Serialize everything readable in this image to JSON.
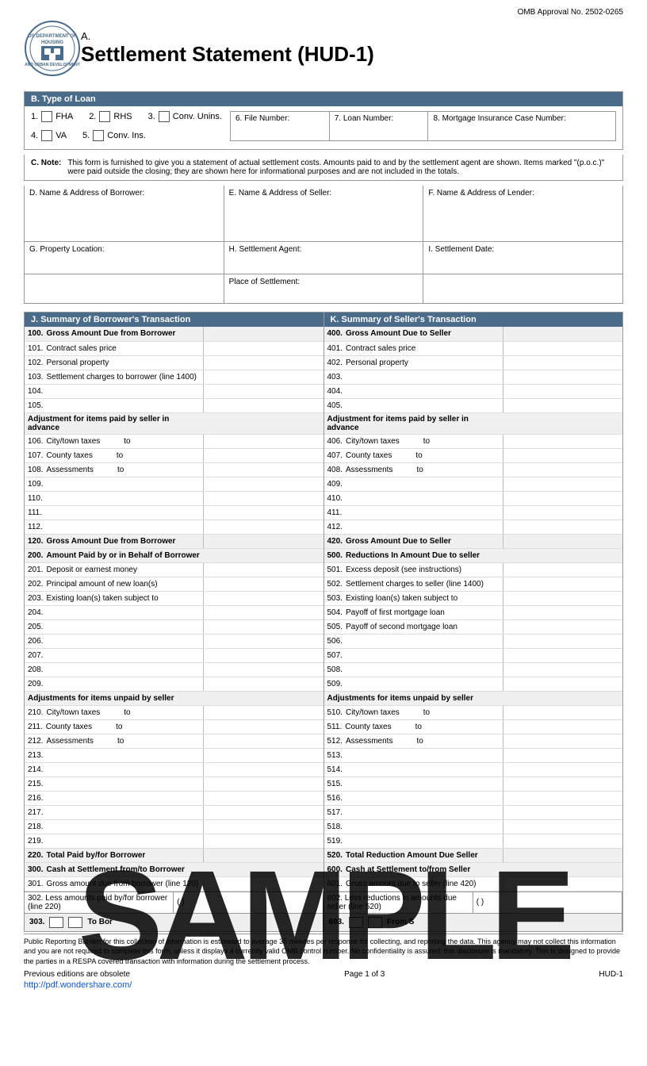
{
  "omb": {
    "label": "OMB Approval No. 2502-0265"
  },
  "title": {
    "prefix": "A.",
    "main": "Settlement Statement (HUD-1)"
  },
  "section_b": {
    "header": "B. Type of Loan",
    "items": [
      {
        "num": "1.",
        "label": "FHA"
      },
      {
        "num": "2.",
        "label": "RHS"
      },
      {
        "num": "3.",
        "label": "Conv. Unins."
      },
      {
        "num": "4.",
        "label": "VA"
      },
      {
        "num": "5.",
        "label": "Conv. Ins."
      }
    ],
    "fields": [
      {
        "label": "6. File Number:"
      },
      {
        "label": "7. Loan Number:"
      },
      {
        "label": "8. Mortgage Insurance Case Number:"
      }
    ]
  },
  "note_c": {
    "label": "C. Note:",
    "text": "This form is furnished to give you a statement of actual settlement costs. Amounts paid to and by the settlement agent are shown. Items marked \"(p.o.c.)\" were paid outside the closing; they are shown here for informational purposes and are not included in the totals."
  },
  "addresses": {
    "borrower": {
      "label": "D. Name & Address of Borrower:"
    },
    "seller": {
      "label": "E. Name & Address of Seller:"
    },
    "lender": {
      "label": "F. Name & Address of Lender:"
    }
  },
  "property": {
    "location": {
      "label": "G. Property Location:"
    },
    "agent": {
      "label": "H. Settlement Agent:"
    },
    "date": {
      "label": "I. Settlement Date:"
    },
    "place": {
      "label": "Place of Settlement:"
    }
  },
  "summary_borrower": {
    "header": "J. Summary of Borrower's Transaction",
    "rows": [
      {
        "num": "100.",
        "label": "Gross Amount Due from Borrower",
        "bold": true,
        "val": ""
      },
      {
        "num": "101.",
        "label": "Contract sales price",
        "bold": false,
        "val": ""
      },
      {
        "num": "102.",
        "label": "Personal property",
        "bold": false,
        "val": ""
      },
      {
        "num": "103.",
        "label": "Settlement charges to borrower (line 1400)",
        "bold": false,
        "val": ""
      },
      {
        "num": "104.",
        "label": "",
        "bold": false,
        "val": ""
      },
      {
        "num": "105.",
        "label": "",
        "bold": false,
        "val": ""
      },
      {
        "num": "",
        "label": "Adjustment for items paid by seller in advance",
        "bold": true,
        "val": null
      },
      {
        "num": "106.",
        "label": "City/town taxes",
        "bold": false,
        "val": "",
        "to": "to"
      },
      {
        "num": "107.",
        "label": "County taxes",
        "bold": false,
        "val": "",
        "to": "to"
      },
      {
        "num": "108.",
        "label": "Assessments",
        "bold": false,
        "val": "",
        "to": "to"
      },
      {
        "num": "109.",
        "label": "",
        "bold": false,
        "val": ""
      },
      {
        "num": "110.",
        "label": "",
        "bold": false,
        "val": ""
      },
      {
        "num": "111.",
        "label": "",
        "bold": false,
        "val": ""
      },
      {
        "num": "112.",
        "label": "",
        "bold": false,
        "val": ""
      },
      {
        "num": "120.",
        "label": "Gross Amount Due from Borrower",
        "bold": true,
        "val": ""
      },
      {
        "num": "200.",
        "label": "Amount Paid by or in Behalf of Borrower",
        "bold": true,
        "val": null
      },
      {
        "num": "201.",
        "label": "Deposit or earnest money",
        "bold": false,
        "val": ""
      },
      {
        "num": "202.",
        "label": "Principal amount of new loan(s)",
        "bold": false,
        "val": ""
      },
      {
        "num": "203.",
        "label": "Existing loan(s) taken subject to",
        "bold": false,
        "val": ""
      },
      {
        "num": "204.",
        "label": "",
        "bold": false,
        "val": ""
      },
      {
        "num": "205.",
        "label": "",
        "bold": false,
        "val": ""
      },
      {
        "num": "206.",
        "label": "",
        "bold": false,
        "val": ""
      },
      {
        "num": "207.",
        "label": "",
        "bold": false,
        "val": ""
      },
      {
        "num": "208.",
        "label": "",
        "bold": false,
        "val": ""
      },
      {
        "num": "209.",
        "label": "",
        "bold": false,
        "val": ""
      },
      {
        "num": "",
        "label": "Adjustments for items unpaid by seller",
        "bold": true,
        "val": null
      },
      {
        "num": "210.",
        "label": "City/town taxes",
        "bold": false,
        "val": "",
        "to": "to"
      },
      {
        "num": "211.",
        "label": "County taxes",
        "bold": false,
        "val": "",
        "to": "to"
      },
      {
        "num": "212.",
        "label": "Assessments",
        "bold": false,
        "val": "",
        "to": "to"
      },
      {
        "num": "213.",
        "label": "",
        "bold": false,
        "val": ""
      },
      {
        "num": "214.",
        "label": "",
        "bold": false,
        "val": ""
      },
      {
        "num": "215.",
        "label": "",
        "bold": false,
        "val": ""
      },
      {
        "num": "216.",
        "label": "",
        "bold": false,
        "val": ""
      },
      {
        "num": "217.",
        "label": "",
        "bold": false,
        "val": ""
      },
      {
        "num": "218.",
        "label": "",
        "bold": false,
        "val": ""
      },
      {
        "num": "219.",
        "label": "",
        "bold": false,
        "val": ""
      },
      {
        "num": "220.",
        "label": "Total Paid by/for Borrower",
        "bold": true,
        "val": ""
      },
      {
        "num": "300.",
        "label": "Cash at Settlement from/to Borrower",
        "bold": true,
        "val": null
      },
      {
        "num": "301.",
        "label": "Gross amount due from borrower (line 120)",
        "bold": false,
        "val": ""
      }
    ],
    "line302": "302. Less amounts paid by/for borrower (line 220)",
    "line302_val": "(                    )",
    "line303": "303.",
    "line303_checkbox1": "",
    "line303_label": "To Bor"
  },
  "summary_seller": {
    "header": "K. Summary of Seller's Transaction",
    "rows": [
      {
        "num": "400.",
        "label": "Gross Amount Due to Seller",
        "bold": true,
        "val": ""
      },
      {
        "num": "401.",
        "label": "Contract sales price",
        "bold": false,
        "val": ""
      },
      {
        "num": "402.",
        "label": "Personal property",
        "bold": false,
        "val": ""
      },
      {
        "num": "403.",
        "label": "",
        "bold": false,
        "val": ""
      },
      {
        "num": "404.",
        "label": "",
        "bold": false,
        "val": ""
      },
      {
        "num": "405.",
        "label": "",
        "bold": false,
        "val": ""
      },
      {
        "num": "",
        "label": "Adjustment for items paid by seller in advance",
        "bold": true,
        "val": null
      },
      {
        "num": "406.",
        "label": "City/town taxes",
        "bold": false,
        "val": "",
        "to": "to"
      },
      {
        "num": "407.",
        "label": "County taxes",
        "bold": false,
        "val": "",
        "to": "to"
      },
      {
        "num": "408.",
        "label": "Assessments",
        "bold": false,
        "val": "",
        "to": "to"
      },
      {
        "num": "409.",
        "label": "",
        "bold": false,
        "val": ""
      },
      {
        "num": "410.",
        "label": "",
        "bold": false,
        "val": ""
      },
      {
        "num": "411.",
        "label": "",
        "bold": false,
        "val": ""
      },
      {
        "num": "412.",
        "label": "",
        "bold": false,
        "val": ""
      },
      {
        "num": "420.",
        "label": "Gross Amount Due to Seller",
        "bold": true,
        "val": ""
      },
      {
        "num": "500.",
        "label": "Reductions In Amount Due to seller",
        "bold": true,
        "val": null
      },
      {
        "num": "501.",
        "label": "Excess deposit (see instructions)",
        "bold": false,
        "val": ""
      },
      {
        "num": "502.",
        "label": "Settlement charges to seller (line 1400)",
        "bold": false,
        "val": ""
      },
      {
        "num": "503.",
        "label": "Existing loan(s) taken subject to",
        "bold": false,
        "val": ""
      },
      {
        "num": "504.",
        "label": "Payoff of first mortgage loan",
        "bold": false,
        "val": ""
      },
      {
        "num": "505.",
        "label": "Payoff of second mortgage loan",
        "bold": false,
        "val": ""
      },
      {
        "num": "506.",
        "label": "",
        "bold": false,
        "val": ""
      },
      {
        "num": "507.",
        "label": "",
        "bold": false,
        "val": ""
      },
      {
        "num": "508.",
        "label": "",
        "bold": false,
        "val": ""
      },
      {
        "num": "509.",
        "label": "",
        "bold": false,
        "val": ""
      },
      {
        "num": "",
        "label": "Adjustments for items unpaid by seller",
        "bold": true,
        "val": null
      },
      {
        "num": "510.",
        "label": "City/town taxes",
        "bold": false,
        "val": "",
        "to": "to"
      },
      {
        "num": "511.",
        "label": "County taxes",
        "bold": false,
        "val": "",
        "to": "to"
      },
      {
        "num": "512.",
        "label": "Assessments",
        "bold": false,
        "val": "",
        "to": "to"
      },
      {
        "num": "513.",
        "label": "",
        "bold": false,
        "val": ""
      },
      {
        "num": "514.",
        "label": "",
        "bold": false,
        "val": ""
      },
      {
        "num": "515.",
        "label": "",
        "bold": false,
        "val": ""
      },
      {
        "num": "516.",
        "label": "",
        "bold": false,
        "val": ""
      },
      {
        "num": "517.",
        "label": "",
        "bold": false,
        "val": ""
      },
      {
        "num": "518.",
        "label": "",
        "bold": false,
        "val": ""
      },
      {
        "num": "519.",
        "label": "",
        "bold": false,
        "val": ""
      },
      {
        "num": "520.",
        "label": "Total Reduction Amount Due Seller",
        "bold": true,
        "val": ""
      },
      {
        "num": "600.",
        "label": "Cash at Settlement to/from Seller",
        "bold": true,
        "val": null
      },
      {
        "num": "601.",
        "label": "Gross amount due to seller (line 420)",
        "bold": false,
        "val": ""
      }
    ],
    "line602": "602. Less reductions in amounts due seller (line 520)",
    "line602_val": "(                    )",
    "line603": "603.",
    "line603_label": "From S"
  },
  "footer": {
    "omb_text": "Public Reporting Burden for this collection of information is estimated to average 35 minutes per response for collecting, and reporting the data. This agency may not collect this information and you are not required to complete this form, unless it displays a currently valid OMB control number. No confidentiality is assured; this disclosure is mandatory. This is designed to provide the parties in a RESPA covered transaction with information during the settlement process.",
    "edition": "Previous editions are obsolete",
    "page": "Page 1 of 3",
    "hud": "HUD-1",
    "watermark": "SAMPLE",
    "wondershare": "http://pdf.wondershare.com/"
  }
}
